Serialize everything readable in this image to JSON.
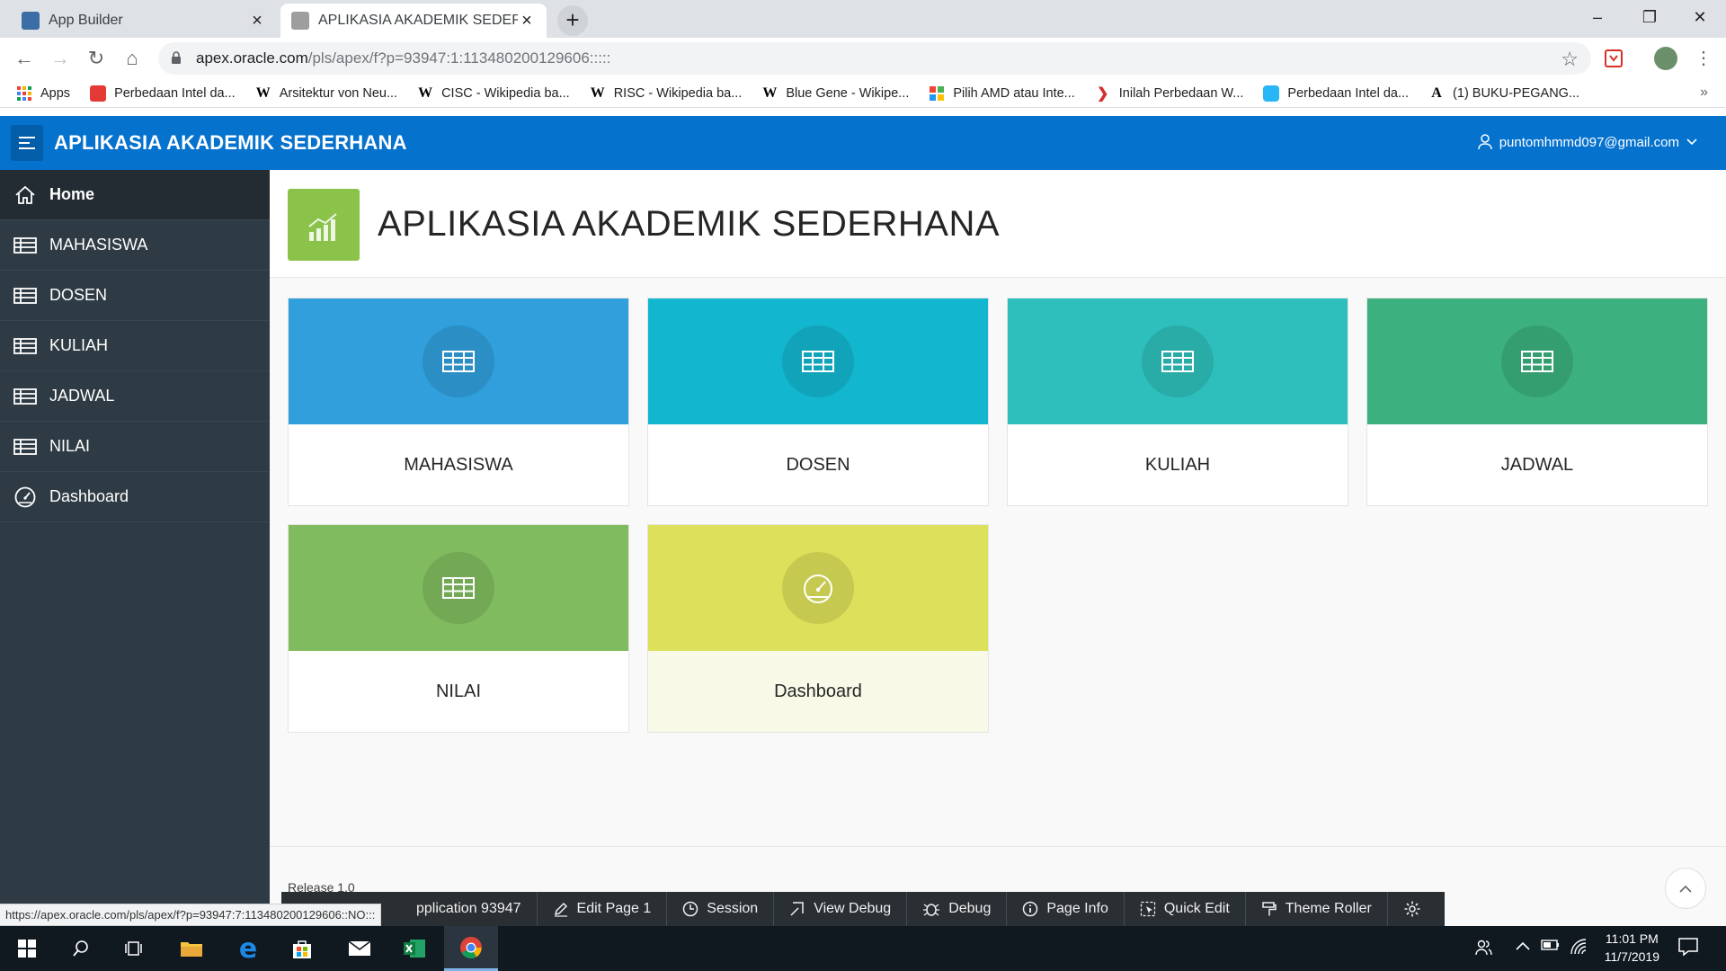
{
  "browser": {
    "tabs": [
      {
        "title": "App Builder"
      },
      {
        "title": "APLIKASIA AKADEMIK SEDERHANA"
      }
    ],
    "url_host": "apex.oracle.com",
    "url_path": "/pls/apex/f?p=93947:1:113480200129606:::::",
    "bookmarks": [
      {
        "label": "Apps",
        "icon": "apps-grid-icon"
      },
      {
        "label": "Perbedaan Intel da...",
        "icon": "site-icon"
      },
      {
        "label": "Arsitektur von Neu...",
        "icon": "wikipedia-icon"
      },
      {
        "label": "CISC - Wikipedia ba...",
        "icon": "wikipedia-icon"
      },
      {
        "label": "RISC - Wikipedia ba...",
        "icon": "wikipedia-icon"
      },
      {
        "label": "Blue Gene - Wikipe...",
        "icon": "wikipedia-icon"
      },
      {
        "label": "Pilih AMD atau Inte...",
        "icon": "site-icon"
      },
      {
        "label": "Inilah Perbedaan W...",
        "icon": "site-icon"
      },
      {
        "label": "Perbedaan Intel da...",
        "icon": "site-icon"
      },
      {
        "label": "(1) BUKU-PEGANG...",
        "icon": "site-icon"
      }
    ],
    "more": "»"
  },
  "header": {
    "title": "APLIKASIA AKADEMIK SEDERHANA",
    "user": "puntomhmmd097@gmail.com"
  },
  "sidebar": {
    "items": [
      {
        "label": "Home",
        "icon": "home-icon"
      },
      {
        "label": "MAHASISWA",
        "icon": "table-icon"
      },
      {
        "label": "DOSEN",
        "icon": "table-icon"
      },
      {
        "label": "KULIAH",
        "icon": "table-icon"
      },
      {
        "label": "JADWAL",
        "icon": "table-icon"
      },
      {
        "label": "NILAI",
        "icon": "table-icon"
      },
      {
        "label": "Dashboard",
        "icon": "dashboard-icon"
      }
    ]
  },
  "main": {
    "hero_title": "APLIKASIA AKADEMIK SEDERHANA",
    "cards": [
      {
        "label": "MAHASISWA",
        "color": "#309fdb",
        "icon": "table-icon"
      },
      {
        "label": "DOSEN",
        "color": "#13b6cf",
        "icon": "table-icon"
      },
      {
        "label": "KULIAH",
        "color": "#2ebfbc",
        "icon": "table-icon"
      },
      {
        "label": "JADWAL",
        "color": "#3cb07e",
        "icon": "table-icon"
      },
      {
        "label": "NILAI",
        "color": "#81bb5f",
        "icon": "table-icon"
      },
      {
        "label": "Dashboard",
        "color": "#dde05a",
        "icon": "dashboard-icon"
      }
    ],
    "release": "Release 1.0"
  },
  "devbar": {
    "items": [
      {
        "label": "pplication 93947"
      },
      {
        "label": "Edit Page 1",
        "icon": "edit-icon"
      },
      {
        "label": "Session",
        "icon": "clock-icon"
      },
      {
        "label": "View Debug",
        "icon": "view-debug-icon"
      },
      {
        "label": "Debug",
        "icon": "bug-icon"
      },
      {
        "label": "Page Info",
        "icon": "info-icon"
      },
      {
        "label": "Quick Edit",
        "icon": "quick-edit-icon"
      },
      {
        "label": "Theme Roller",
        "icon": "paint-roller-icon"
      }
    ]
  },
  "status_url": "https://apex.oracle.com/pls/apex/f?p=93947:7:113480200129606::NO:::",
  "taskbar": {
    "time": "11:01 PM",
    "date": "11/7/2019"
  }
}
